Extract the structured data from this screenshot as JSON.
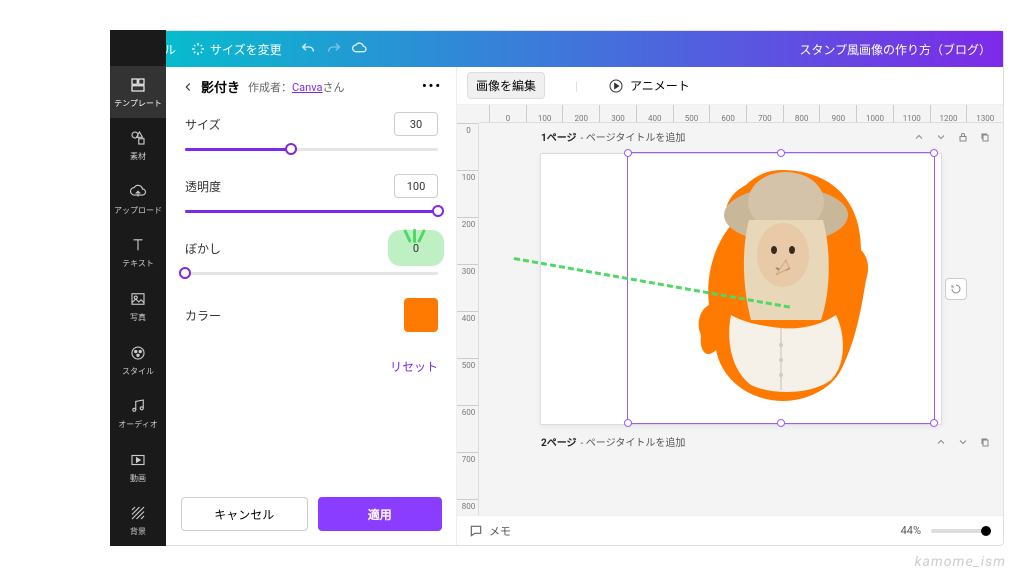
{
  "topbar": {
    "file": "ファイル",
    "resize": "サイズを変更",
    "title": "スタンプ風画像の作り方（ブログ）"
  },
  "leftnav": [
    {
      "id": "template",
      "label": "テンプレート"
    },
    {
      "id": "elements",
      "label": "素材"
    },
    {
      "id": "upload",
      "label": "アップロード"
    },
    {
      "id": "text",
      "label": "テキスト"
    },
    {
      "id": "photo",
      "label": "写真"
    },
    {
      "id": "style",
      "label": "スタイル"
    },
    {
      "id": "audio",
      "label": "オーディオ"
    },
    {
      "id": "video",
      "label": "動画"
    },
    {
      "id": "bg",
      "label": "背景"
    }
  ],
  "panel": {
    "title": "影付き",
    "author_prefix": "作成者：",
    "author_link": "Canva",
    "author_suffix": "さん",
    "controls": {
      "size": {
        "label": "サイズ",
        "value": "30",
        "pct": 42
      },
      "opacity": {
        "label": "透明度",
        "value": "100",
        "pct": 100
      },
      "blur": {
        "label": "ぼかし",
        "value": "0",
        "pct": 0
      },
      "color_label": "カラー",
      "color": "#ff7a00"
    },
    "reset": "リセット",
    "cancel": "キャンセル",
    "apply": "適用"
  },
  "toolbar": {
    "edit_image": "画像を編集",
    "animate": "アニメート"
  },
  "ruler_h": [
    "0",
    "100",
    "200",
    "300",
    "400",
    "500",
    "600",
    "700",
    "800",
    "900",
    "1000",
    "1100",
    "1200",
    "1300"
  ],
  "ruler_v": [
    "0",
    "100",
    "200",
    "300",
    "400",
    "500",
    "600",
    "700",
    "800"
  ],
  "pages": {
    "p1_num": "1ページ",
    "p2_num": "2ページ",
    "title_placeholder": "- ページタイトルを追加"
  },
  "bottombar": {
    "memo": "メモ",
    "zoom": "44%"
  },
  "watermark": "kamome_ism"
}
